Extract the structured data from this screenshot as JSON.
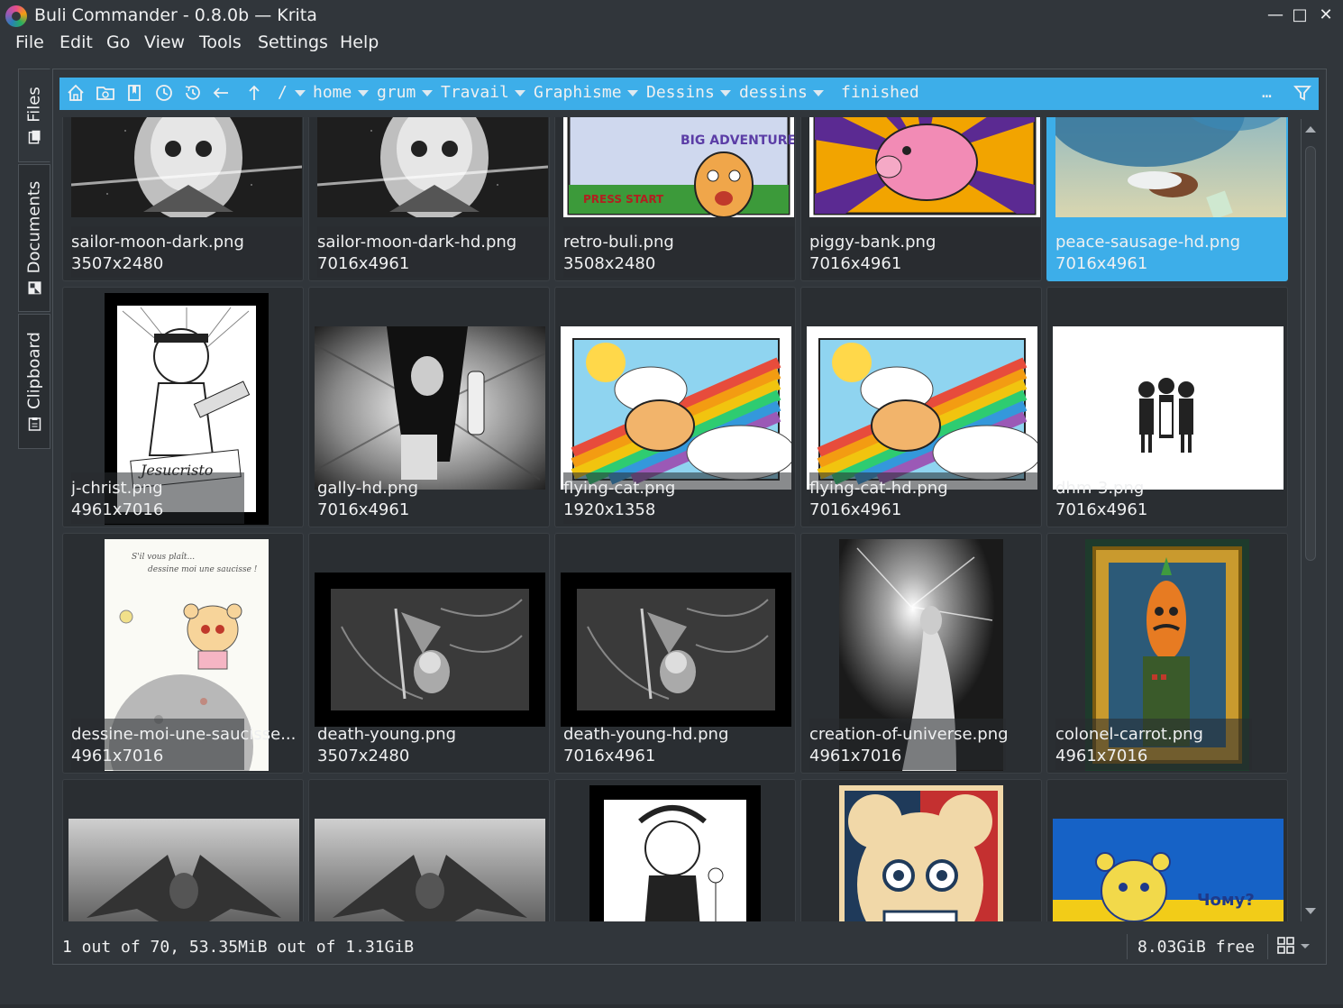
{
  "window": {
    "title": "Buli Commander - 0.8.0b — Krita",
    "minimize": "—",
    "maximize": "□",
    "close": "✕"
  },
  "menubar": [
    "File",
    "Edit",
    "Go",
    "View",
    "Tools",
    "Settings",
    "Help"
  ],
  "dock_tabs": [
    {
      "label": "Files",
      "icon": "files-icon"
    },
    {
      "label": "Documents",
      "icon": "documents-icon"
    },
    {
      "label": "Clipboard",
      "icon": "clipboard-icon"
    }
  ],
  "pathbar": {
    "root": "/",
    "crumbs": [
      "home",
      "grum",
      "Travail",
      "Graphisme",
      "Dessins",
      "dessins",
      "finished"
    ],
    "more": "…",
    "icons": [
      "home-icon",
      "open-folder-icon",
      "bookmarks-icon",
      "history-back-icon",
      "history-icon",
      "back-arrow-icon",
      "up-arrow-icon",
      "filter-icon"
    ]
  },
  "files": [
    {
      "name": "sailor-moon-dark.png",
      "size": "3507x2480",
      "art": "mono-space"
    },
    {
      "name": "sailor-moon-dark-hd.png",
      "size": "7016x4961",
      "art": "mono-space"
    },
    {
      "name": "retro-buli.png",
      "size": "3508x2480",
      "art": "retro"
    },
    {
      "name": "piggy-bank.png",
      "size": "7016x4961",
      "art": "piggy"
    },
    {
      "name": "peace-sausage-hd.png",
      "size": "7016x4961",
      "art": "sausage",
      "selected": true
    },
    {
      "name": "j-christ.png",
      "size": "4961x7016",
      "art": "jchrist"
    },
    {
      "name": "gally-hd.png",
      "size": "7016x4961",
      "art": "gally"
    },
    {
      "name": "flying-cat.png",
      "size": "1920x1358",
      "art": "rainbow"
    },
    {
      "name": "flying-cat-hd.png",
      "size": "7016x4961",
      "art": "rainbow"
    },
    {
      "name": "dhm-3.png",
      "size": "7016x4961",
      "art": "dhm"
    },
    {
      "name": "dessine-moi-une-saucisse...",
      "size": "4961x7016",
      "art": "dessine"
    },
    {
      "name": "death-young.png",
      "size": "3507x2480",
      "art": "death"
    },
    {
      "name": "death-young-hd.png",
      "size": "7016x4961",
      "art": "death"
    },
    {
      "name": "creation-of-universe.png",
      "size": "4961x7016",
      "art": "creation"
    },
    {
      "name": "colonel-carrot.png",
      "size": "4961x7016",
      "art": "carrot"
    },
    {
      "name": "",
      "size": "",
      "art": "cthulhu"
    },
    {
      "name": "",
      "size": "",
      "art": "cthulhu"
    },
    {
      "name": "",
      "size": "",
      "art": "geisha"
    },
    {
      "name": "",
      "size": "",
      "art": "poster"
    },
    {
      "name": "",
      "size": "",
      "art": "ukraine"
    }
  ],
  "overlay_texts": {
    "retro_title": "BIG ADVENTURE!",
    "retro_press": "PRESS START",
    "jchrist_sign": "Jesucristo",
    "dessine_line1": "S'il vous plaît...",
    "dessine_line2": "dessine moi une saucisse !",
    "ukraine_text": "Чому?"
  },
  "statusbar": {
    "selection": "1 out of 70, 53.35MiB out of 1.31GiB",
    "free": "8.03GiB free",
    "view_icon": "grid-view-icon"
  },
  "colors": {
    "accent": "#3daee9",
    "background": "#31363b",
    "tile": "#2a2e32",
    "text": "#eff0f1"
  }
}
